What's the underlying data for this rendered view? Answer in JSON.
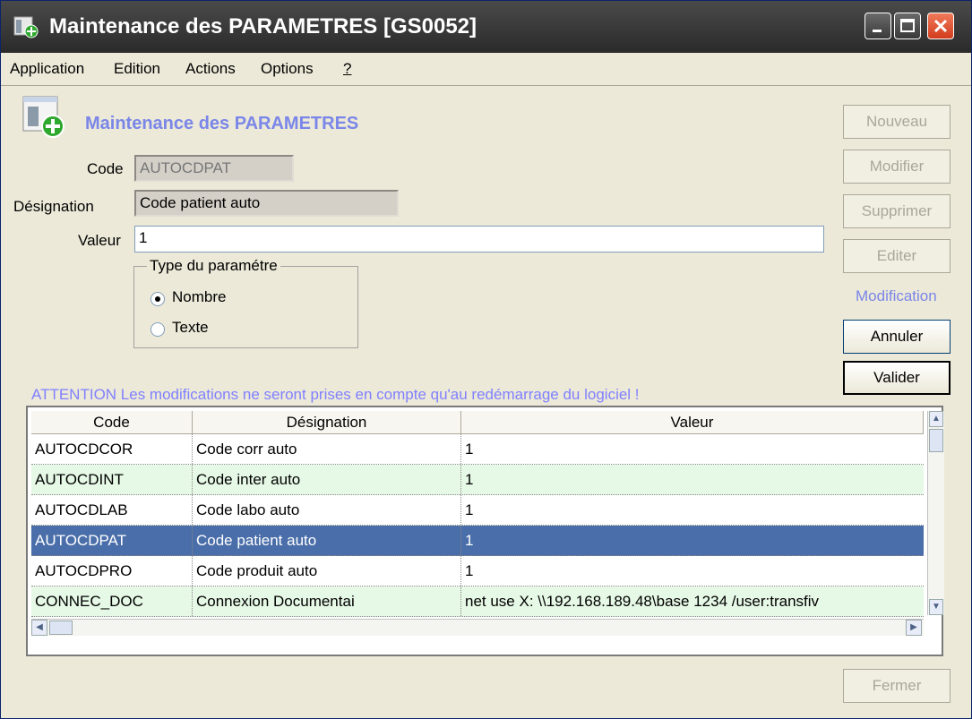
{
  "window": {
    "title": "Maintenance des PARAMETRES  [GS0052]"
  },
  "menu": [
    {
      "label": "Application",
      "underline": "A"
    },
    {
      "label": "Edition",
      "underline": "E"
    },
    {
      "label": "Actions",
      "underline": "A"
    },
    {
      "label": "Options",
      "underline": "O"
    },
    {
      "label": "?",
      "underline": "?"
    }
  ],
  "header": {
    "title": "Maintenance des PARAMETRES"
  },
  "form": {
    "code_label": "Code",
    "code_value": "AUTOCDPAT",
    "designation_label": "Désignation",
    "designation_value": "Code patient auto",
    "valeur_label": "Valeur",
    "valeur_value": "1",
    "type_legend": "Type du paramétre",
    "type_options": [
      "Nombre",
      "Texte"
    ],
    "type_selected": "Nombre"
  },
  "warning": "ATTENTION Les modifications ne seront prises en compte qu'au redémarrage du logiciel !",
  "actions": {
    "nouveau": "Nouveau",
    "modifier": "Modifier",
    "supprimer": "Supprimer",
    "editer": "Editer",
    "mode_label": "Modification",
    "annuler": "Annuler",
    "valider": "Valider",
    "fermer": "Fermer"
  },
  "table": {
    "columns": [
      "Code",
      "Désignation",
      "Valeur"
    ],
    "rows": [
      [
        "AUTOCDCOR",
        "Code corr auto",
        "1"
      ],
      [
        "AUTOCDINT",
        "Code inter auto",
        "1"
      ],
      [
        "AUTOCDLAB",
        "Code labo auto",
        "1"
      ],
      [
        "AUTOCDPAT",
        "Code patient auto",
        "1"
      ],
      [
        "AUTOCDPRO",
        "Code produit auto",
        "1"
      ],
      [
        "CONNEC_DOC",
        "Connexion Documentai",
        "net use X: \\\\192.168.189.48\\base 1234 /user:transfiv"
      ]
    ],
    "selected_index": 3
  },
  "colors": {
    "accent_text": "#7a86e8",
    "selected_row": "#4a6ea9",
    "alt_row": "#e6f8e6"
  }
}
